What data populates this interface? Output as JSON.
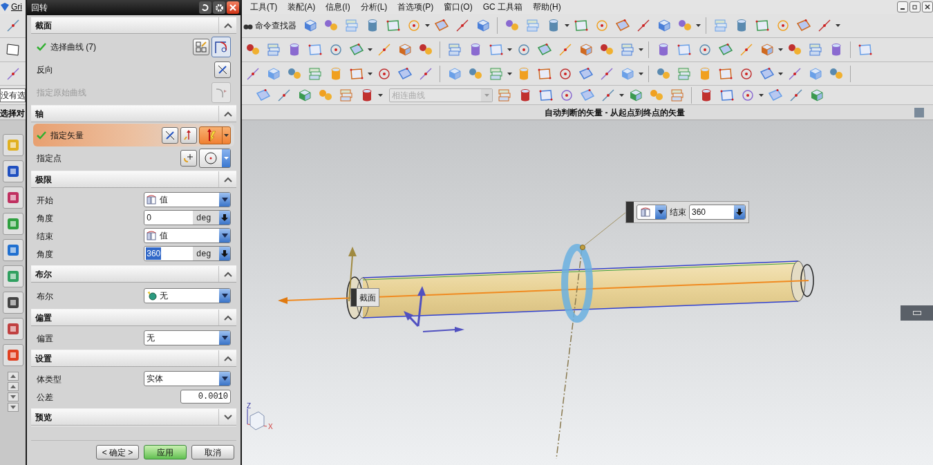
{
  "app_title": "Gri",
  "menu": [
    "工具(T)",
    "装配(A)",
    "信息(I)",
    "分析(L)",
    "首选项(P)",
    "窗口(O)",
    "GC 工具箱",
    "帮助(H)"
  ],
  "command_finder": "命令查找器",
  "selection_filter": "没有选",
  "curve_rule": {
    "value": "相连曲线",
    "disabled": true
  },
  "left_label": "选择对",
  "status_prompt": "自动判断的矢量 - 从起点到终点的矢量",
  "dialog": {
    "title": "回转",
    "sections": [
      {
        "title": "截面",
        "expanded": true,
        "rows": [
          {
            "kind": "selection",
            "label": "选择曲线 (7)",
            "checked": true,
            "highlighted": false,
            "disabled": false
          },
          {
            "kind": "selection",
            "label": "反向",
            "checked": false,
            "highlighted": false,
            "disabled": false
          },
          {
            "kind": "selection",
            "label": "指定原始曲线",
            "checked": false,
            "highlighted": false,
            "disabled": true
          }
        ]
      },
      {
        "title": "轴",
        "expanded": true,
        "rows": [
          {
            "kind": "selection",
            "label": "指定矢量",
            "checked": true,
            "highlighted": true,
            "disabled": false
          },
          {
            "kind": "selection",
            "label": "指定点",
            "checked": false,
            "highlighted": false,
            "disabled": false
          }
        ]
      },
      {
        "title": "极限",
        "expanded": true,
        "rows": [
          {
            "kind": "dropdown",
            "label": "开始",
            "value": "值"
          },
          {
            "kind": "expression",
            "label": "角度",
            "value": "0",
            "unit": "deg",
            "selected": false
          },
          {
            "kind": "dropdown",
            "label": "结束",
            "value": "值"
          },
          {
            "kind": "expression",
            "label": "角度",
            "value": "360",
            "unit": "deg",
            "selected": true
          }
        ]
      },
      {
        "title": "布尔",
        "expanded": true,
        "rows": [
          {
            "kind": "dropdown",
            "label": "布尔",
            "value": "无"
          }
        ]
      },
      {
        "title": "偏置",
        "expanded": true,
        "rows": [
          {
            "kind": "dropdown",
            "label": "偏置",
            "value": "无"
          }
        ]
      },
      {
        "title": "设置",
        "expanded": true,
        "rows": [
          {
            "kind": "dropdown",
            "label": "体类型",
            "value": "实体"
          },
          {
            "kind": "number",
            "label": "公差",
            "value": "0.0010"
          }
        ]
      },
      {
        "title": "预览",
        "expanded": false
      }
    ],
    "buttons": [
      {
        "label": "< 确定 >",
        "default": false
      },
      {
        "label": "应用",
        "default": true
      },
      {
        "label": "取消",
        "default": false
      }
    ]
  },
  "viewport": {
    "section_label": "截面",
    "end_popup": {
      "label": "结束",
      "value": "360"
    },
    "axis_labels": [
      "Z",
      "X"
    ]
  }
}
